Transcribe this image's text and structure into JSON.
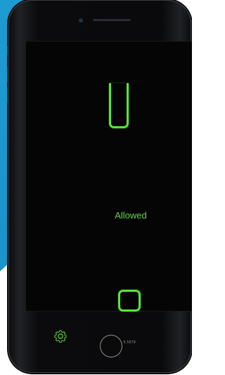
{
  "status": {
    "label": "Allowed",
    "color": "#66d34b"
  },
  "indicators": {
    "top": "open-rectangle",
    "bottom": "rounded-square",
    "color": "#59e636"
  },
  "footer": {
    "settings_icon": "gear-icon",
    "version": "5.5679"
  },
  "device": {
    "home_button": "home-button"
  },
  "colors": {
    "background_accent": "#1d9bd3",
    "screen": "#050505"
  }
}
